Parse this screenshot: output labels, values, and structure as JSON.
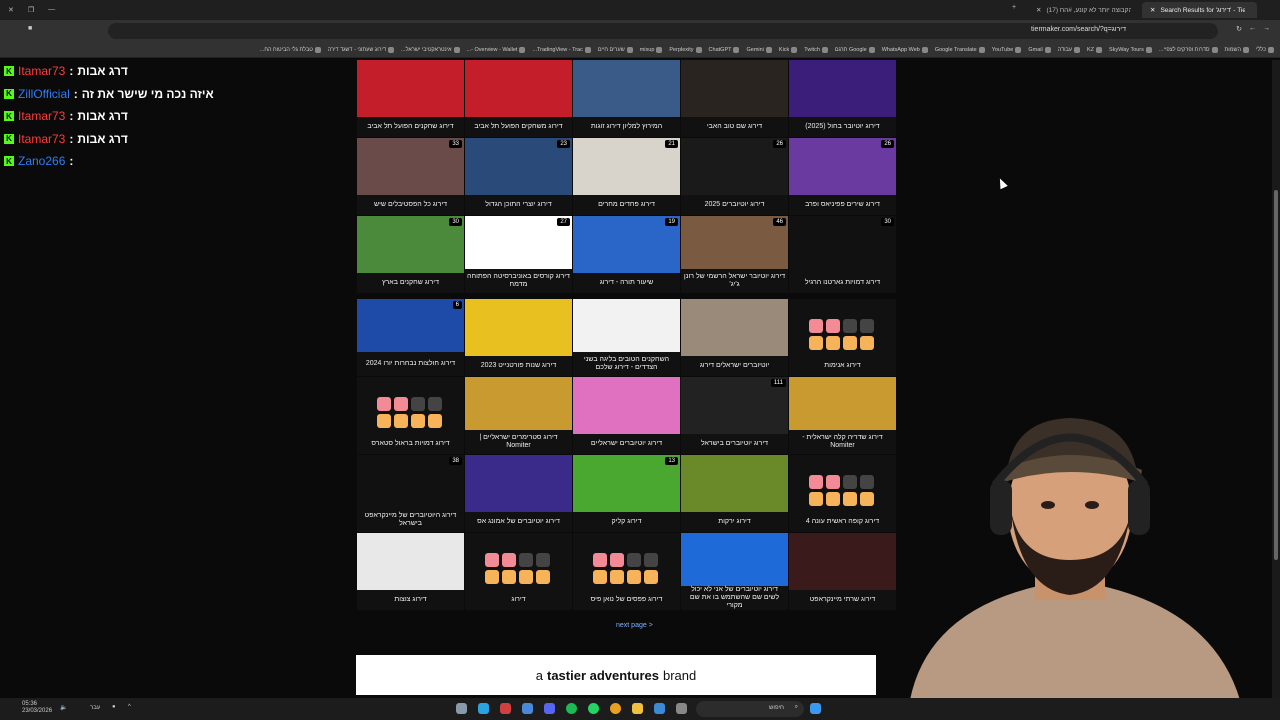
{
  "browser": {
    "tabs": [
      {
        "title": "Search Results for 'דירוג' - Tier...",
        "active": true
      },
      {
        "title": "(17) הקבוצה יותר לא קונע, #הח...",
        "active": false
      }
    ],
    "url": "tiermaker.com/search/?q=דירוג",
    "bookmarks": [
      "כללי",
      "השמות",
      "סדרות ופרקים לצפיי...",
      "SkyWay Tours",
      "KZ",
      "עבודה",
      "Gmail",
      "YouTube",
      "Google Translate",
      "WhatsApp Web",
      "Google תרגם",
      "Twitch",
      "Kick",
      "Gemini",
      "ChatGPT",
      "Perplexity",
      "mixup",
      "שערים חיים",
      "TradingView - Trac...",
      "Overview - Wallet -...",
      "אינטראקטיבי ישראל...",
      "דירוג שעתוני - דשגד דירה",
      "טבלת גלי הביטוח הח..."
    ]
  },
  "chat": [
    {
      "user": "Itamar73",
      "user_color": "#ff3b3b",
      "message": "דרג אבות"
    },
    {
      "user": "ZillOfficial",
      "user_color": "#2e7df7",
      "message": "איזה נכה מי שישר את זה"
    },
    {
      "user": "Itamar73",
      "user_color": "#ff3b3b",
      "message": "דרג אבות"
    },
    {
      "user": "Itamar73",
      "user_color": "#ff3b3b",
      "message": "דרג אבות"
    },
    {
      "user": "Zano266",
      "user_color": "#2e7df7",
      "message": ""
    }
  ],
  "grid_top": [
    {
      "caption": "דירוג שחקנים הפועל תל אביב",
      "badge": "",
      "bg": "#c41e2a"
    },
    {
      "caption": "דירוג משחקים הפועל תל אביב",
      "badge": "",
      "bg": "#c41e2a"
    },
    {
      "caption": "המירוץ למליון דירוג זוגות",
      "badge": "",
      "bg": "#3a5a88"
    },
    {
      "caption": "דירוג שם טוב האבי",
      "badge": "",
      "bg": "#2a2420"
    },
    {
      "caption": "דירוג יוטיובר בחול (2025)",
      "badge": "",
      "bg": "#3b1d7a"
    },
    {
      "caption": "דירוג כל הפסטיבלים שיש",
      "badge": "33",
      "bg": "#6b4a4a"
    },
    {
      "caption": "דירוג יוצרי התוכן הגדול",
      "badge": "23",
      "bg": "#2a4a7a"
    },
    {
      "caption": "דירוג פחדים מחרים",
      "badge": "21",
      "bg": "#d8d4cc"
    },
    {
      "caption": "דירוג יוטיוברים 2025",
      "badge": "26",
      "bg": "#1a1a1a"
    },
    {
      "caption": "דירוג שירים פפיניאס ופרב",
      "badge": "26",
      "bg": "#6a3aa0"
    },
    {
      "caption": "דירוג שחקנים בארץ",
      "badge": "30",
      "bg": "#4a8a3a"
    },
    {
      "caption": "דירוג קורסים באוניברסיטה הפתוחה מדמח",
      "badge": "27",
      "bg": "#ffffff"
    },
    {
      "caption": "שיעור תורה - דירוג",
      "badge": "19",
      "bg": "#2a66c8"
    },
    {
      "caption": "דירוג יוטיובר ישראל הרשמי של רונן ג'יג'",
      "badge": "46",
      "bg": "#7a5a40"
    },
    {
      "caption": "דירוג דמויות גארטנו הרגיל",
      "badge": "30",
      "bg": "#111111"
    }
  ],
  "grid_bottom": [
    {
      "caption": "דירוג חולצות נבחרות יורו 2024",
      "badge": "6",
      "bg": "#1e4aa8"
    },
    {
      "caption": "דירוג שנות פורטנייט 2023",
      "badge": "",
      "bg": "#e8c020"
    },
    {
      "caption": "השחקנים הטובים בליגה בשני הצדדים - דירוג שלכם",
      "badge": "",
      "bg": "#f2f2f2"
    },
    {
      "caption": "יוטיוברים ישראלים דירוג",
      "badge": "",
      "bg": "#9a8a7a"
    },
    {
      "caption": "דירוג אנימות",
      "badge": "",
      "bg": "tiles"
    },
    {
      "caption": "דירוג דמויות בראול סטארס",
      "badge": "",
      "bg": "tiles"
    },
    {
      "caption": "דירוג סטרימרים ישראליים | Nomiter",
      "badge": "",
      "bg": "#c89a30"
    },
    {
      "caption": "דירוג יוטיוברים ישראליים",
      "badge": "",
      "bg": "#e070c0"
    },
    {
      "caption": "דירוג יוטיוברים בישראל",
      "badge": "111",
      "bg": "#222222"
    },
    {
      "caption": "דירוג שדריה קלה ישראלית - Nomiter",
      "badge": "",
      "bg": "#c89a30"
    },
    {
      "caption": "דירוג היוטיוברים של מיינקראפט בישראל",
      "badge": "38",
      "bg": "#111111"
    },
    {
      "caption": "דירוג יוטיוברים של אמונג אס",
      "badge": "",
      "bg": "#3a2a8a"
    },
    {
      "caption": "דירוג קליק",
      "badge": "13",
      "bg": "#4aa830"
    },
    {
      "caption": "דירוג ירקות",
      "badge": "",
      "bg": "#6a8a2a"
    },
    {
      "caption": "דירוג קופה ראשית עונה 4",
      "badge": "",
      "bg": "tiles"
    },
    {
      "caption": "דירוג צוצות",
      "badge": "",
      "bg": "#e8e8e8"
    },
    {
      "caption": "דירוג",
      "badge": "",
      "bg": "tiles"
    },
    {
      "caption": "דירוג פפסים של נואן פיס",
      "badge": "",
      "bg": "tiles"
    },
    {
      "caption": "דירוג יוטיוברים של אני לא יכול לשים שם שהשתמש בו את שם מקורי",
      "badge": "",
      "bg": "#1e6ad8"
    },
    {
      "caption": "דירוג שרתי מיינקראפט",
      "badge": "",
      "bg": "#3a1a1a"
    }
  ],
  "next_page": "next page >",
  "banner": {
    "pre": "a",
    "bold": "tastier adventures",
    "post": "brand"
  },
  "taskbar": {
    "time": "05:36",
    "date": "23/03/2026",
    "search": "חיפוש",
    "lang": "עבר"
  },
  "colors": {
    "tile_pink": "#f28b95",
    "tile_orange": "#f6b35a",
    "tile_gray": "#444444"
  }
}
